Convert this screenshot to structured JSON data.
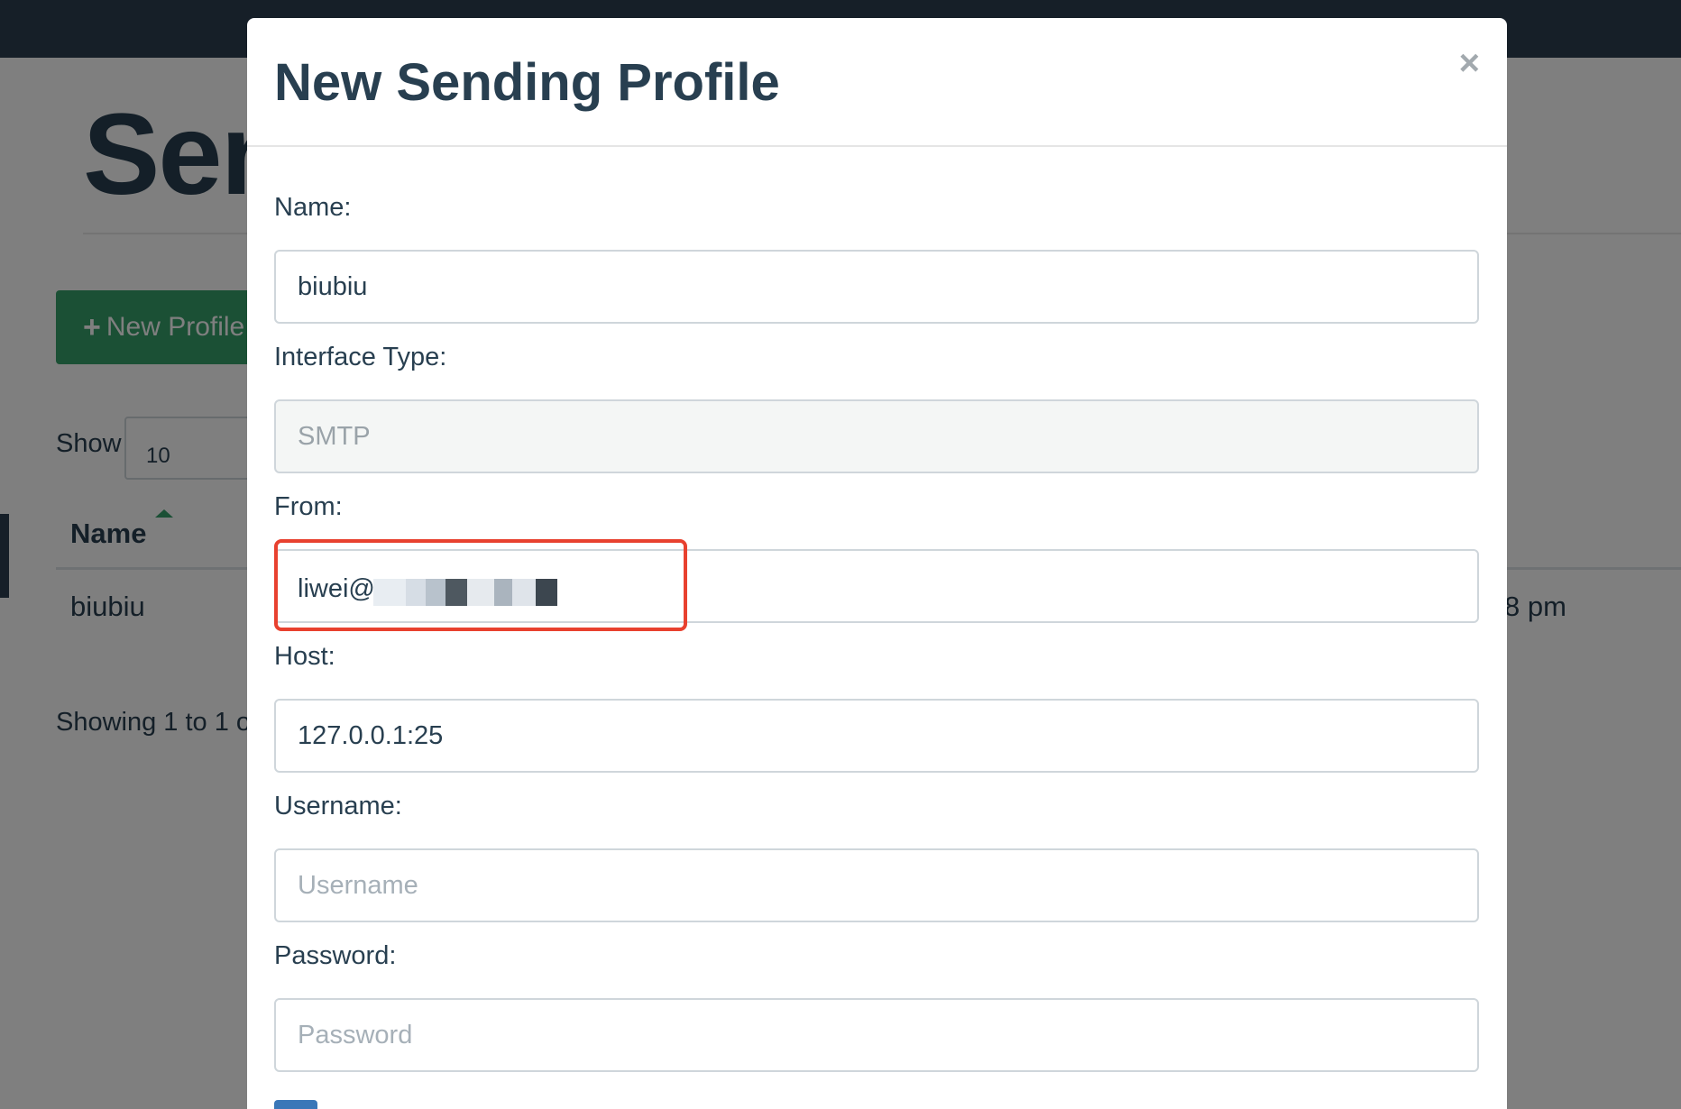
{
  "background": {
    "page_title": "Sen",
    "new_profile_button": "New Profile",
    "show_label": "Show",
    "page_size": "10",
    "table": {
      "column_name": "Name",
      "row_name": "biubiu",
      "row_date_fragment": "8 pm"
    },
    "footer_text": "Showing 1 to 1 of"
  },
  "modal": {
    "title": "New Sending Profile",
    "close_symbol": "×",
    "fields": {
      "name": {
        "label": "Name:",
        "value": "biubiu"
      },
      "interface_type": {
        "label": "Interface Type:",
        "value": "SMTP"
      },
      "from": {
        "label": "From:",
        "value": "liwei@"
      },
      "host": {
        "label": "Host:",
        "value": "127.0.0.1:25"
      },
      "username": {
        "label": "Username:",
        "value": "",
        "placeholder": "Username"
      },
      "password": {
        "label": "Password:",
        "value": "",
        "placeholder": "Password"
      }
    }
  },
  "colors": {
    "navbar": "#2c3e50",
    "primary_text": "#283f50",
    "success_button": "#37a06a",
    "highlight": "#e8412f",
    "primary_button": "#3a77b8"
  }
}
